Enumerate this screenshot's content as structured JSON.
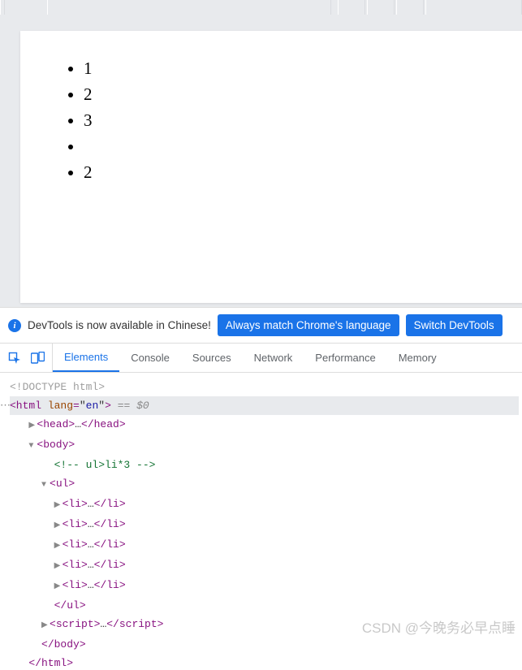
{
  "page": {
    "list_items": [
      "1",
      "2",
      "3",
      "",
      "2"
    ]
  },
  "info_bar": {
    "message": "DevTools is now available in Chinese!",
    "btn_match": "Always match Chrome's language",
    "btn_switch": "Switch DevTools"
  },
  "tabs": {
    "elements": "Elements",
    "console": "Console",
    "sources": "Sources",
    "network": "Network",
    "performance": "Performance",
    "memory": "Memory"
  },
  "dom": {
    "doctype": "<!DOCTYPE html>",
    "html_open": "<html lang=\"en\">",
    "sel_marker": " == $0",
    "head": "<head>…</head>",
    "body_open": "<body>",
    "comment": "<!-- ul>li*3 -->",
    "ul_open": "<ul>",
    "li": "<li>…</li>",
    "ul_close": "</ul>",
    "script": "<script>…</script>",
    "body_close": "</body>",
    "html_close": "</html>"
  },
  "watermark": "CSDN @今晚务必早点睡"
}
